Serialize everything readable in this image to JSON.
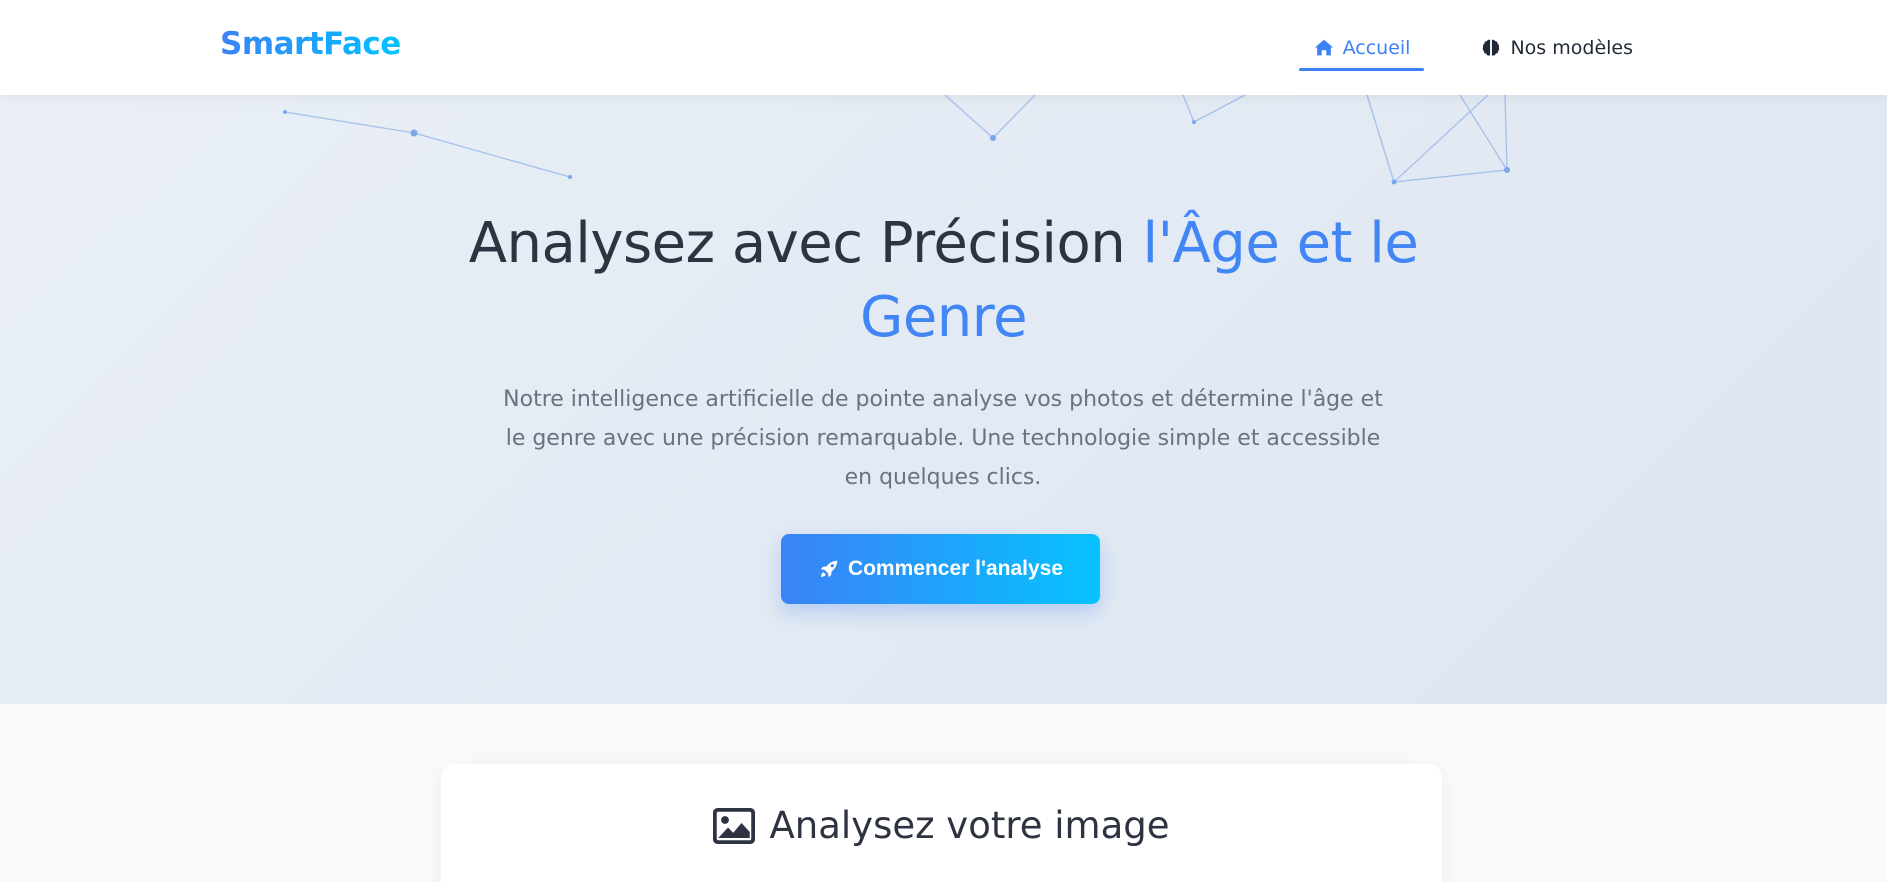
{
  "brand": {
    "name": "SmartFace"
  },
  "nav": {
    "items": [
      {
        "label": "Accueil",
        "icon": "home-icon",
        "active": true
      },
      {
        "label": "Nos modèles",
        "icon": "brain-icon",
        "active": false
      }
    ]
  },
  "hero": {
    "title_main": "Analysez avec Précision",
    "title_accent_1": "l'Âge et le",
    "title_accent_2": "Genre",
    "subtitle": "Notre intelligence artificielle de pointe analyse vos photos et détermine l'âge et le genre avec une précision remarquable. Une technologie simple et accessible en quelques clics.",
    "cta_label": "Commencer l'analyse",
    "cta_icon": "rocket-icon"
  },
  "analysis": {
    "title": "Analysez votre image",
    "icon": "image-icon"
  },
  "colors": {
    "accent": "#4285f4",
    "brand_gradient_start": "#3b82f6",
    "brand_gradient_end": "#00c2ff",
    "text_dark": "#2d3340",
    "text_muted": "#6b7280"
  }
}
